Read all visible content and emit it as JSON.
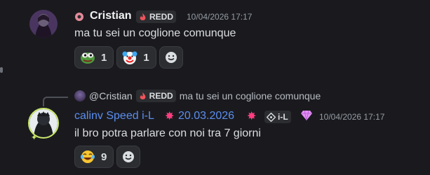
{
  "messages": [
    {
      "author": "Cristian",
      "tag": "REDD",
      "timestamp": "10/04/2026 17:17",
      "content": "ma tu sei un coglione comunque",
      "reactions": [
        {
          "emoji": "pepe-frog",
          "count": "1"
        },
        {
          "emoji": "clown-face",
          "count": "1"
        }
      ]
    },
    {
      "reply": {
        "author": "@Cristian",
        "tag": "REDD",
        "content": "ma tu sei un coglione comunque"
      },
      "author": "calinv Speed i-L",
      "date": "20.03.2026",
      "tag": "i-L",
      "timestamp": "10/04/2026 17:17",
      "content": "il bro potra parlare con noi tra 7 giorni",
      "reactions": [
        {
          "emoji": "face-with-tears-of-joy",
          "count": "9"
        }
      ]
    }
  ],
  "colors": {
    "background": "#1a1a1e",
    "author1": "#f2f3f5",
    "author2": "#5b8ef0",
    "timestamp": "#949ba4",
    "pill": "#2b2d31"
  }
}
